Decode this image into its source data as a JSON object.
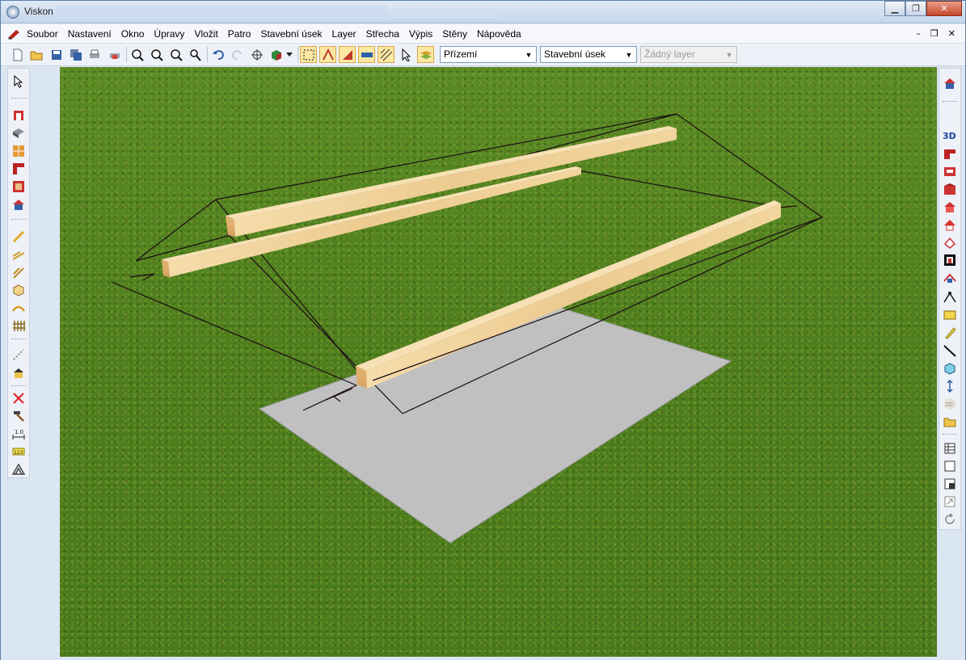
{
  "window": {
    "title": "Viskon",
    "controls": {
      "minimize": "▁",
      "maximize": "❐",
      "close": "✕"
    }
  },
  "menu": {
    "items": [
      "Soubor",
      "Nastavení",
      "Okno",
      "Úpravy",
      "Vložit",
      "Patro",
      "Stavební úsek",
      "Layer",
      "Střecha",
      "Výpis",
      "Stěny",
      "Nápověda"
    ],
    "mdi_controls": {
      "minimize": "–",
      "restore": "❐",
      "close": "✕"
    }
  },
  "toolbar": {
    "icons": [
      "new-file-icon",
      "open-folder-icon",
      "save-icon",
      "save-all-icon",
      "print-icon",
      "print-preview-icon",
      "zoom-in-icon",
      "zoom-out-icon",
      "zoom-fit-icon",
      "zoom-window-icon",
      "undo-icon",
      "redo-icon",
      "crosshair-icon",
      "3d-box-icon",
      "dropdown-arrow-icon",
      "select-area-icon",
      "snap-icon",
      "roof-icon",
      "section-icon",
      "hatch-icon",
      "pointer-icon",
      "layer-stack-icon"
    ],
    "floor_select": {
      "value": "Přízemí"
    },
    "section_select": {
      "value": "Stavební úsek"
    },
    "layer_select": {
      "value": "Žádný layer"
    }
  },
  "left_toolbar": {
    "icons": [
      "pointer-icon",
      "wall-icon",
      "slab-icon",
      "window-icon",
      "corner-icon",
      "frame-icon",
      "house-icon",
      "beam-icon",
      "stair-icon",
      "rafter-icon",
      "box-icon",
      "arch-icon",
      "fence-icon",
      "line-icon",
      "roof-object-icon",
      "delete-icon",
      "hammer-icon",
      "dimension-icon",
      "measure-icon",
      "truss-icon"
    ]
  },
  "right_toolbar": {
    "icons": [
      "house-view-icon",
      "3d-view-icon",
      "floor-view-icon",
      "section-view-icon",
      "front-view-icon",
      "side-view-icon",
      "roof-view-icon",
      "elevation-icon",
      "plan-icon",
      "camera-icon",
      "path-icon",
      "panel-icon",
      "tilt-icon",
      "line-tool-icon",
      "cube-tool-icon",
      "height-icon",
      "2d-icon",
      "folder-icon",
      "grid-icon",
      "blank-icon",
      "half-icon",
      "expand-icon",
      "refresh-icon"
    ]
  },
  "colors": {
    "grass": "#4f7f1e",
    "slab": "#bfbfbf",
    "timber": "#e9c08a",
    "wire": "#1a0a14",
    "highlight": "#fce7a3"
  }
}
